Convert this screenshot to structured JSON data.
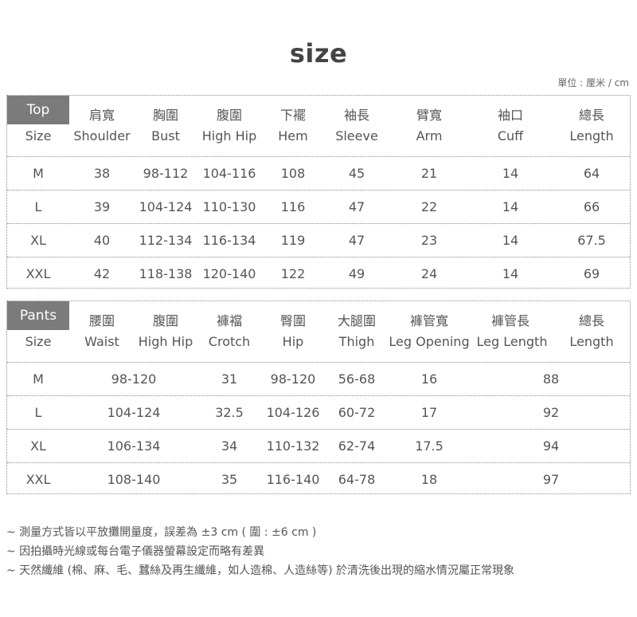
{
  "title": "size",
  "unit": "單位 : 厘米 / cm",
  "top": {
    "label": "Top",
    "headers_zh": [
      "",
      "肩寬",
      "胸圍",
      "腹圍",
      "下襬",
      "袖長",
      "臂寬",
      "袖口",
      "總長"
    ],
    "headers_en": [
      "Size",
      "Shoulder",
      "Bust",
      "High Hip",
      "Hem",
      "Sleeve",
      "Arm",
      "Cuff",
      "Length"
    ],
    "rows": [
      [
        "M",
        "38",
        "98-112",
        "104-116",
        "108",
        "45",
        "21",
        "14",
        "64"
      ],
      [
        "L",
        "39",
        "104-124",
        "110-130",
        "116",
        "47",
        "22",
        "14",
        "66"
      ],
      [
        "XL",
        "40",
        "112-134",
        "116-134",
        "119",
        "47",
        "23",
        "14",
        "67.5"
      ],
      [
        "XXL",
        "42",
        "118-138",
        "120-140",
        "122",
        "49",
        "24",
        "14",
        "69"
      ]
    ]
  },
  "pants": {
    "label": "Pants",
    "headers_zh": [
      "",
      "腰圍",
      "腹圍",
      "褲襠",
      "臀圍",
      "大腿圍",
      "褲管寬",
      "褲管長",
      "總長"
    ],
    "headers_en": [
      "Size",
      "Waist",
      "High Hip",
      "Crotch",
      "Hip",
      "Thigh",
      "Leg Opening",
      "Leg Length",
      "Length"
    ],
    "rows": [
      [
        "M",
        "98-120",
        "31",
        "98-120",
        "56-68",
        "16",
        "88"
      ],
      [
        "L",
        "104-124",
        "32.5",
        "104-126",
        "60-72",
        "17",
        "92"
      ],
      [
        "XL",
        "106-134",
        "34",
        "110-132",
        "62-74",
        "17.5",
        "94"
      ],
      [
        "XXL",
        "108-140",
        "35",
        "116-140",
        "64-78",
        "18",
        "97"
      ]
    ]
  },
  "notes": [
    "~ 測量方式皆以平放攤開量度，誤差為 ±3 cm ( 圍 : ±6 cm )",
    "~ 因拍攝時光線或每台電子儀器螢幕設定而略有差異",
    "~ 天然纖維 (棉、麻、毛、蠶絲及再生纖維，如人造棉、人造絲等) 於清洗後出現的縮水情況屬正常現象"
  ]
}
